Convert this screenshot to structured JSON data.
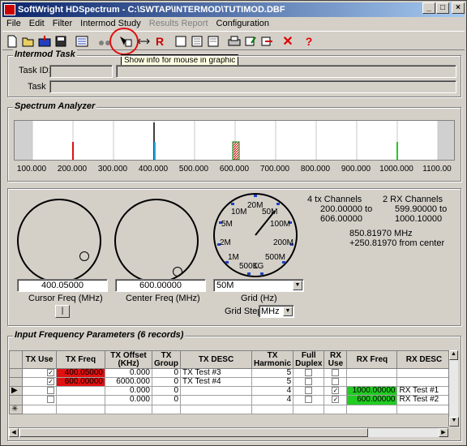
{
  "window": {
    "title": "SoftWright HDSpectrum - C:\\SWTAP\\INTERMOD\\TUTIMOD.DBF",
    "btn_min": "_",
    "btn_max": "□",
    "btn_close": "×"
  },
  "menu": [
    "File",
    "Edit",
    "Filter",
    "Intermod Study",
    "Results Report",
    "Configuration"
  ],
  "tooltip": "Show info for mouse in graphic",
  "intermod_task": {
    "legend": "Intermod Task",
    "task_id_label": "Task ID:",
    "task_label": "Task",
    "task_id_value": "",
    "task_value": ""
  },
  "spectrum": {
    "legend": "Spectrum Analyzer",
    "ticks": [
      "100.000",
      "200.000",
      "300.000",
      "400.000",
      "500.000",
      "600.000",
      "700.000",
      "800.000",
      "900.000",
      "1000.000",
      "1100.00"
    ]
  },
  "controls": {
    "cursor_freq": "400.05000",
    "cursor_label": "Cursor Freq (MHz)",
    "center_freq": "600.00000",
    "center_label": "Center Freq (MHz)",
    "grid_value": "50M",
    "grid_label": "Grid (Hz)",
    "grid_step_label": "Grid Step",
    "grid_step_value": "MHz",
    "small_btn": "|",
    "dial_labels": [
      "20M",
      "10M",
      "50M",
      "5M",
      "100M",
      "2M",
      "200M",
      "1M",
      "500M",
      "500K",
      "1G"
    ]
  },
  "info": {
    "tx_title": "4 tx Channels",
    "tx_range1": "200.00000 to",
    "tx_range2": "606.00000",
    "rx_title": "2 RX Channels",
    "rx_range1": "599.90000 to",
    "rx_range2": "1000.10000",
    "cursor_mhz": "850.81970 MHz",
    "from_center": "+250.81970 from center"
  },
  "table": {
    "legend": "Input Frequency Parameters (6 records)",
    "headers": [
      "TX Use",
      "TX Freq",
      "TX Offset (KHz)",
      "TX Group",
      "TX DESC",
      "TX Harmonic",
      "Full Duplex",
      "RX Use",
      "RX Freq",
      "RX DESC"
    ],
    "rows": [
      {
        "marker": "",
        "tx_use": "✓",
        "tx_freq": "400.05000",
        "offset": "0.000",
        "group": "0",
        "desc": "TX Test #3",
        "harm": "5",
        "duplex": "",
        "rx_use": "",
        "rx_freq": "",
        "rx_desc": ""
      },
      {
        "marker": "",
        "tx_use": "✓",
        "tx_freq": "600.00000",
        "offset": "6000.000",
        "group": "0",
        "desc": "TX Test #4",
        "harm": "5",
        "duplex": "",
        "rx_use": "",
        "rx_freq": "",
        "rx_desc": ""
      },
      {
        "marker": "▶",
        "tx_use": "",
        "tx_freq": "",
        "offset": "0.000",
        "group": "0",
        "desc": "",
        "harm": "4",
        "duplex": "",
        "rx_use": "✓",
        "rx_freq": "1000.00000",
        "rx_desc": "RX Test #1"
      },
      {
        "marker": "",
        "tx_use": "",
        "tx_freq": "",
        "offset": "0.000",
        "group": "0",
        "desc": "",
        "harm": "4",
        "duplex": "",
        "rx_use": "✓",
        "rx_freq": "600.00000",
        "rx_desc": "RX Test #2"
      },
      {
        "marker": "✳",
        "tx_use": "",
        "tx_freq": "",
        "offset": "",
        "group": "",
        "desc": "",
        "harm": "",
        "duplex": "",
        "rx_use": "",
        "rx_freq": "",
        "rx_desc": ""
      }
    ]
  },
  "colors": {
    "tx_freq_bg": "#e01010",
    "rx_freq_bg": "#22cc22"
  }
}
